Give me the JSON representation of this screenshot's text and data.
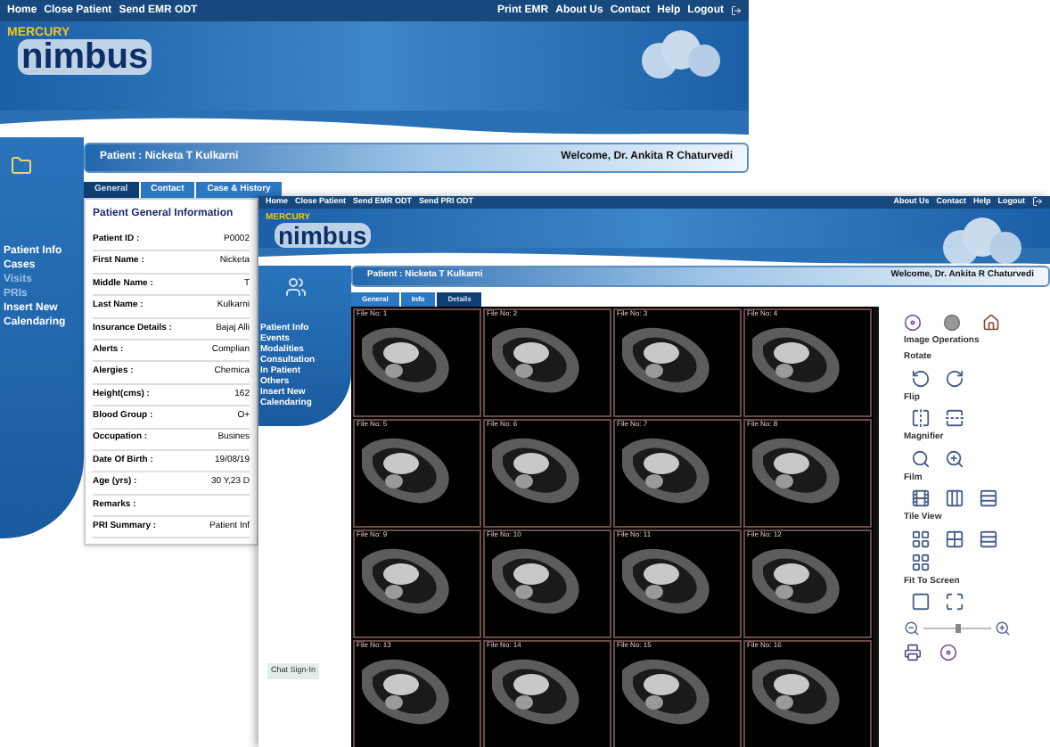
{
  "back_screen": {
    "nav_left": [
      "Home",
      "Close Patient",
      "Send EMR ODT"
    ],
    "nav_right": [
      "Print EMR",
      "About Us",
      "Contact",
      "Help",
      "Logout"
    ],
    "logo": {
      "brand": "MERCURY",
      "name": "nimbus"
    },
    "patient": "Patient : Nicketa T Kulkarni",
    "welcome": "Welcome, Dr. Ankita R Chaturvedi",
    "tabs": [
      {
        "label": "General",
        "selected": true
      },
      {
        "label": "Contact",
        "selected": false
      },
      {
        "label": "Case & History",
        "selected": false
      }
    ],
    "sidebar": [
      {
        "label": "Patient Info",
        "disabled": false
      },
      {
        "label": "Cases",
        "disabled": false
      },
      {
        "label": "Visits",
        "disabled": true
      },
      {
        "label": "PRIs",
        "disabled": true
      },
      {
        "label": "Insert New",
        "disabled": false
      },
      {
        "label": "Calendaring",
        "disabled": false
      }
    ],
    "panel": {
      "title": "Patient General Information",
      "rows": [
        {
          "label": "Patient ID :",
          "value": "P0002"
        },
        {
          "label": "First Name :",
          "value": "Nicketa"
        },
        {
          "label": "Middle Name :",
          "value": "T"
        },
        {
          "label": "Last Name :",
          "value": "Kulkarni"
        },
        {
          "label": "Insurance Details :",
          "value": "Bajaj Alli"
        },
        {
          "label": "Alerts :",
          "value": "Complian"
        },
        {
          "label": "Alergies :",
          "value": "Chemica"
        },
        {
          "label": "Height(cms) :",
          "value": "162"
        },
        {
          "label": "Blood Group :",
          "value": "O+"
        },
        {
          "label": "Occupation :",
          "value": "Busines"
        },
        {
          "label": "Date Of Birth :",
          "value": "19/08/19"
        },
        {
          "label": "Age (yrs) :",
          "value": "30 Y,23 D"
        },
        {
          "label": "Remarks :"
        },
        {
          "label": "PRI Summary :",
          "value": "Patient Inf"
        }
      ]
    }
  },
  "front_screen": {
    "nav_left": [
      "Home",
      "Close Patient",
      "Send EMR ODT",
      "Send PRI ODT"
    ],
    "nav_right": [
      "About Us",
      "Contact",
      "Help",
      "Logout"
    ],
    "logo": {
      "brand": "MERCURY",
      "name": "nimbus"
    },
    "patient": "Patient : Nicketa T Kulkarni",
    "welcome": "Welcome, Dr. Ankita R Chaturvedi",
    "tabs": [
      {
        "label": "General",
        "selected": false
      },
      {
        "label": "Info",
        "selected": false
      },
      {
        "label": "Details",
        "selected": true
      }
    ],
    "sidebar": [
      {
        "label": "Patient Info"
      },
      {
        "label": "Events"
      },
      {
        "label": "Modalities"
      },
      {
        "label": "Consultation"
      },
      {
        "label": "In Patient"
      },
      {
        "label": "Others"
      },
      {
        "label": "Insert New"
      },
      {
        "label": "Calendaring"
      }
    ],
    "chat_button": "Chat Sign-In",
    "tiles": [
      "File No: 1",
      "File No: 2",
      "File No: 3",
      "File No: 4",
      "File No: 5",
      "File No: 6",
      "File No: 7",
      "File No: 8",
      "File No: 9",
      "File No: 10",
      "File No: 11",
      "File No: 12",
      "File No: 13",
      "File No: 14",
      "File No: 15",
      "File No: 16"
    ],
    "tools": {
      "heading": "Image Operations",
      "sections": [
        "Rotate",
        "Flip",
        "Magnifier",
        "Film",
        "Tile View",
        "Fit To Screen"
      ],
      "zoom": {
        "level": 0.5
      }
    }
  }
}
